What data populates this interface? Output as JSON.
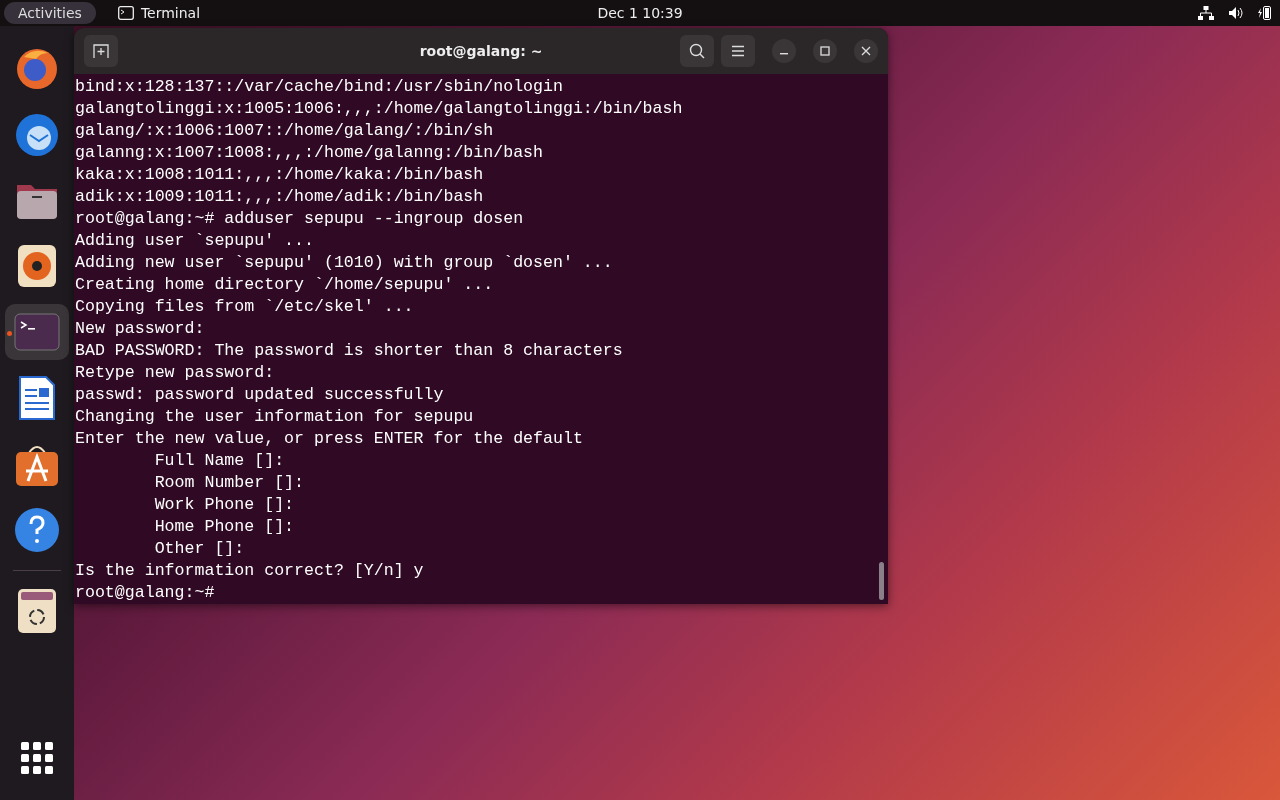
{
  "top_bar": {
    "activities": "Activities",
    "app_name": "Terminal",
    "clock": "Dec 1  10:39"
  },
  "dock": [
    {
      "kind": "firefox",
      "running": false
    },
    {
      "kind": "thunderbird",
      "running": false
    },
    {
      "kind": "files",
      "running": false
    },
    {
      "kind": "rhythmbox",
      "running": false
    },
    {
      "kind": "terminal",
      "running": true
    },
    {
      "kind": "writer",
      "running": false
    },
    {
      "kind": "appcenter",
      "running": false
    },
    {
      "kind": "help",
      "running": false
    },
    {
      "kind": "trash",
      "running": false
    }
  ],
  "window": {
    "title": "root@galang: ~",
    "lines": [
      "bind:x:128:137::/var/cache/bind:/usr/sbin/nologin",
      "galangtolinggi:x:1005:1006:,,,:/home/galangtolinggi:/bin/bash",
      "galang/:x:1006:1007::/home/galang/:/bin/sh",
      "galanng:x:1007:1008:,,,:/home/galanng:/bin/bash",
      "kaka:x:1008:1011:,,,:/home/kaka:/bin/bash",
      "adik:x:1009:1011:,,,:/home/adik:/bin/bash",
      "root@galang:~# adduser sepupu --ingroup dosen",
      "Adding user `sepupu' ...",
      "Adding new user `sepupu' (1010) with group `dosen' ...",
      "Creating home directory `/home/sepupu' ...",
      "Copying files from `/etc/skel' ...",
      "New password:",
      "BAD PASSWORD: The password is shorter than 8 characters",
      "Retype new password:",
      "passwd: password updated successfully",
      "Changing the user information for sepupu",
      "Enter the new value, or press ENTER for the default",
      "        Full Name []:",
      "        Room Number []:",
      "        Work Phone []:",
      "        Home Phone []:",
      "        Other []:",
      "Is the information correct? [Y/n] y",
      "root@galang:~#"
    ]
  }
}
